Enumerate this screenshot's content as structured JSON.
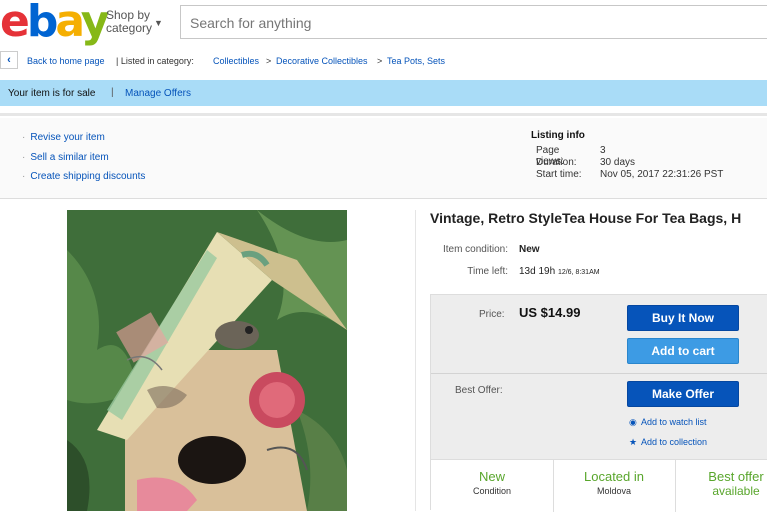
{
  "header": {
    "logo": [
      "e",
      "b",
      "a",
      "y"
    ],
    "shop_by": "Shop by",
    "category": "category",
    "search_placeholder": "Search for anything"
  },
  "breadcrumb": {
    "back_label": "Back to home page",
    "listed_in": "| Listed in category:",
    "items": [
      "Collectibles",
      "Decorative Collectibles",
      "Tea Pots, Sets"
    ],
    "sep": ">"
  },
  "sale_bar": {
    "text": "Your item is for sale",
    "sep": "|",
    "manage": "Manage Offers"
  },
  "seller_tools": {
    "links": [
      "Revise your item",
      "Sell a similar item",
      "Create shipping discounts"
    ]
  },
  "listing_info": {
    "heading": "Listing info",
    "rows": [
      {
        "k": "Page views:",
        "v": "3"
      },
      {
        "k": "Duration:",
        "v": "30 days"
      },
      {
        "k": "Start time:",
        "v": "Nov 05, 2017 22:31:26 PST"
      }
    ]
  },
  "item": {
    "title": "Vintage, Retro StyleTea House For Tea Bags, H",
    "condition_label": "Item condition:",
    "condition_value": "New",
    "time_left_label": "Time left:",
    "time_left_value": "13d 19h",
    "time_left_end": "12/6, 8:31AM"
  },
  "purchase": {
    "price_label": "Price:",
    "price_value": "US $14.99",
    "buy_now": "Buy It Now",
    "add_to_cart": "Add to cart",
    "best_offer_label": "Best Offer:",
    "make_offer": "Make Offer",
    "watch": "Add to watch list",
    "collection": "Add to collection"
  },
  "features": [
    {
      "big": "New",
      "small": "Condition"
    },
    {
      "big": "Located in",
      "small": "Moldova"
    },
    {
      "big": "Best offer",
      "small": "available"
    }
  ],
  "colors": {
    "ebay_red": "#e53238",
    "ebay_blue": "#0064d2",
    "ebay_yellow": "#f5af02",
    "ebay_green": "#86b817",
    "link_blue": "#0654ba",
    "sale_bar": "#a9dcf7",
    "feature_green": "#59a62c"
  }
}
